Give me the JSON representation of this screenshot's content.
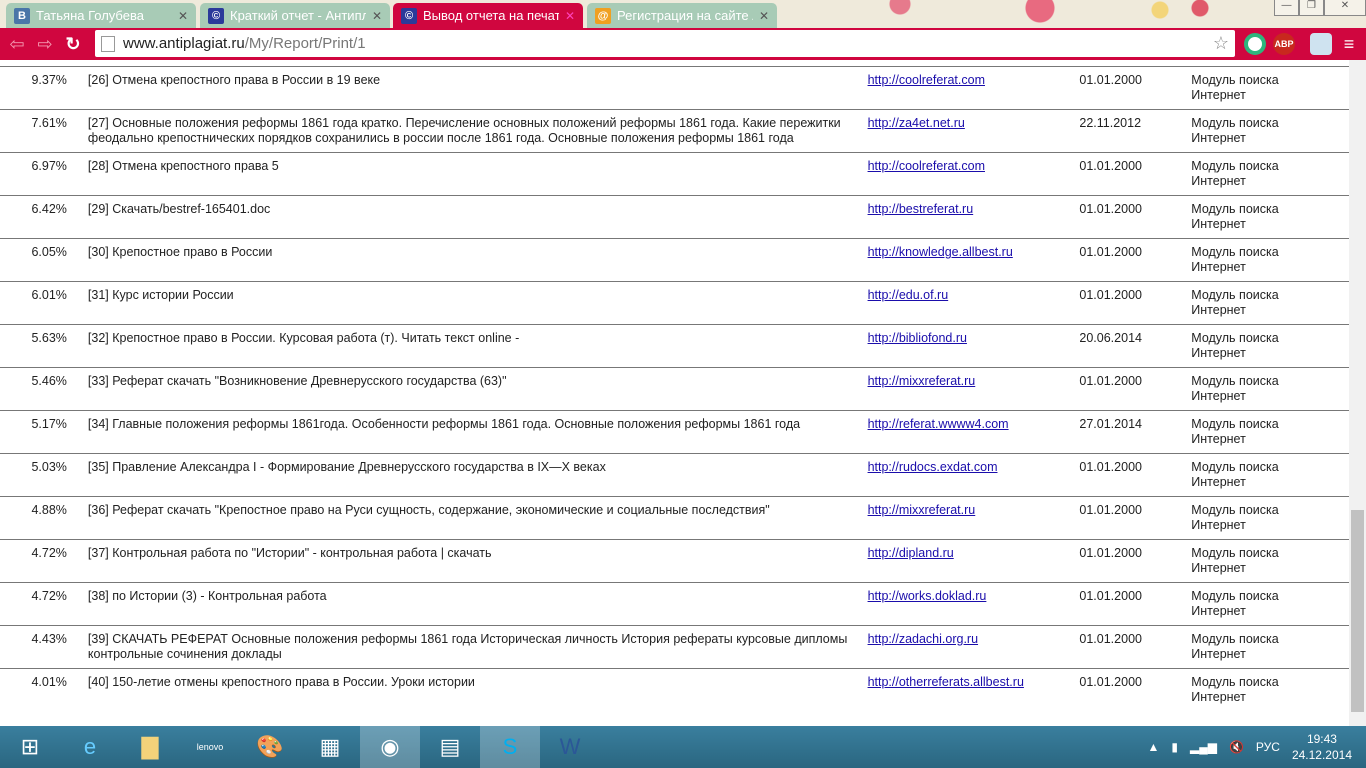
{
  "tabs": [
    {
      "title": "Татьяна Голубева",
      "favicon": "В",
      "color": "#4a76a8"
    },
    {
      "title": "Краткий отчет - Антипла",
      "favicon": "©",
      "color": "#2b3a9a"
    },
    {
      "title": "Вывод отчета на печать -",
      "favicon": "©",
      "color": "#2b3a9a",
      "active": true
    },
    {
      "title": "Регистрация на сайте Ан",
      "favicon": "@",
      "color": "#f0a020"
    }
  ],
  "url": {
    "domain": "www.antiplagiat.ru",
    "path": "/My/Report/Print/1"
  },
  "extensions": [
    "ABP"
  ],
  "rows": [
    {
      "pct": "9.37%",
      "name": "[26] Отмена крепостного права в России в 19 веке",
      "url": "http://coolreferat.com",
      "date": "01.01.2000",
      "module": "Модуль поиска Интернет"
    },
    {
      "pct": "7.61%",
      "name": "[27] Основные положения реформы 1861 года кратко. Перечисление основных положений реформы 1861 года. Какие пережитки феодально крепостнических порядков сохранились в россии после 1861 года. Основные положения реформы 1861 года",
      "url": "http://za4et.net.ru",
      "date": "22.11.2012",
      "module": "Модуль поиска Интернет"
    },
    {
      "pct": "6.97%",
      "name": "[28] Отмена крепостного права 5",
      "url": "http://coolreferat.com",
      "date": "01.01.2000",
      "module": "Модуль поиска Интернет"
    },
    {
      "pct": "6.42%",
      "name": "[29] Скачать/bestref-165401.doc",
      "url": "http://bestreferat.ru",
      "date": "01.01.2000",
      "module": "Модуль поиска Интернет"
    },
    {
      "pct": "6.05%",
      "name": "[30] Крепостное право в России",
      "url": "http://knowledge.allbest.ru",
      "date": "01.01.2000",
      "module": "Модуль поиска Интернет"
    },
    {
      "pct": "6.01%",
      "name": "[31] Курс истории России",
      "url": "http://edu.of.ru",
      "date": "01.01.2000",
      "module": "Модуль поиска Интернет"
    },
    {
      "pct": "5.63%",
      "name": "[32] Крепостное право в России. Курсовая работа (т). Читать текст online -",
      "url": "http://bibliofond.ru",
      "date": "20.06.2014",
      "module": "Модуль поиска Интернет"
    },
    {
      "pct": "5.46%",
      "name": "[33] Реферат скачать \"Возникновение Древнерусского государства (63)\"",
      "url": "http://mixxreferat.ru",
      "date": "01.01.2000",
      "module": "Модуль поиска Интернет"
    },
    {
      "pct": "5.17%",
      "name": "[34] Главные положения реформы 1861года. Особенности реформы 1861 года. Основные положения реформы 1861 года",
      "url": "http://referat.wwww4.com",
      "date": "27.01.2014",
      "module": "Модуль поиска Интернет"
    },
    {
      "pct": "5.03%",
      "name": "[35] Правление Александра I - Формирование Древнерусского государства в IX—X веках",
      "url": "http://rudocs.exdat.com",
      "date": "01.01.2000",
      "module": "Модуль поиска Интернет"
    },
    {
      "pct": "4.88%",
      "name": "[36] Реферат скачать \"Крепостное право на Руси сущность, содержание, экономические и социальные последствия\"",
      "url": "http://mixxreferat.ru",
      "date": "01.01.2000",
      "module": "Модуль поиска Интернет"
    },
    {
      "pct": "4.72%",
      "name": "[37] Контрольная работа по \"Истории\" - контрольная работа | скачать",
      "url": "http://dipland.ru",
      "date": "01.01.2000",
      "module": "Модуль поиска Интернет"
    },
    {
      "pct": "4.72%",
      "name": "[38] по Истории (3) - Контрольная работа",
      "url": "http://works.doklad.ru",
      "date": "01.01.2000",
      "module": "Модуль поиска Интернет"
    },
    {
      "pct": "4.43%",
      "name": "[39] СКАЧАТЬ РЕФЕРАТ Основные положения реформы 1861 года Историческая личность История рефераты курсовые дипломы контрольные сочинения доклады",
      "url": "http://zadachi.org.ru",
      "date": "01.01.2000",
      "module": "Модуль поиска Интернет"
    },
    {
      "pct": "4.01%",
      "name": "[40] 150-летие отмены крепостного права в России. Уроки истории",
      "url": "http://otherreferats.allbest.ru",
      "date": "01.01.2000",
      "module": "Модуль поиска Интернет"
    }
  ],
  "tray": {
    "lang": "РУС",
    "time": "19:43",
    "date": "24.12.2014"
  }
}
